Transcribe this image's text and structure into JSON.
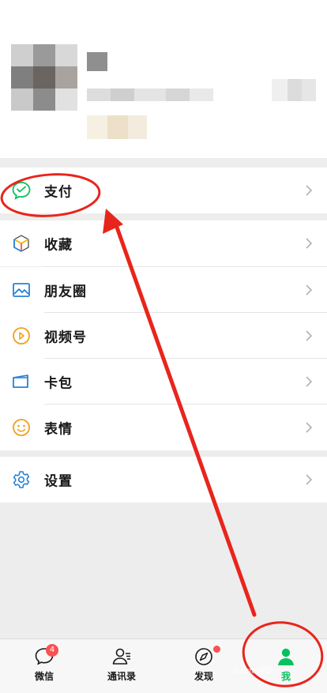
{
  "profile": {
    "avatar_alt": "avatar (pixelated)",
    "name_blur": "",
    "id_blur": "",
    "status_blur": ""
  },
  "menu": {
    "pay": "支付",
    "favorites": "收藏",
    "moments": "朋友圈",
    "channels": "视频号",
    "cards": "卡包",
    "stickers": "表情",
    "settings": "设置"
  },
  "tabs": [
    {
      "label": "微信",
      "badge": "4"
    },
    {
      "label": "通讯录"
    },
    {
      "label": "发现"
    },
    {
      "label": "我"
    }
  ],
  "colors": {
    "accent": "#07c160",
    "annotation": "#e8251c",
    "badge": "#fa5151"
  },
  "watermark": "Baidu经验"
}
